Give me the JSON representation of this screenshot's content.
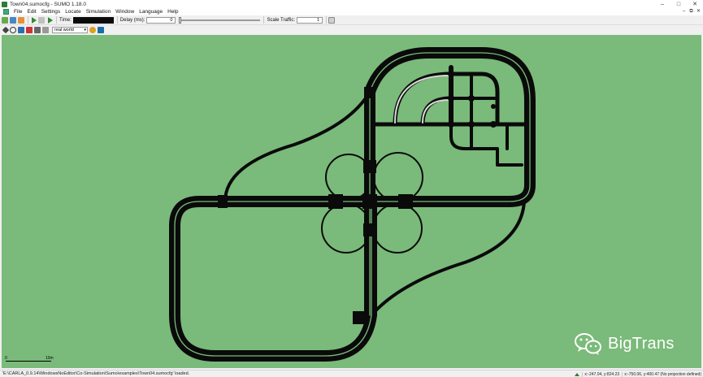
{
  "window": {
    "title": "Town04.sumocfg - SUMO 1.18.0",
    "minimize": "–",
    "maximize": "□",
    "close": "✕"
  },
  "menu": {
    "items": [
      "File",
      "Edit",
      "Settings",
      "Locate",
      "Simulation",
      "Window",
      "Language",
      "Help"
    ],
    "mdi_minimize": "–",
    "mdi_restore": "⧉",
    "mdi_close": "✕"
  },
  "toolbar": {
    "time_label": "Time:",
    "time_value": "",
    "delay_label": "Delay (ms):",
    "delay_value": "0",
    "delay_level": 0,
    "scale_label": "Scale Traffic:",
    "scale_value": "1"
  },
  "view_toolbar": {
    "scheme_value": "real world"
  },
  "scale_bar": {
    "start": "0",
    "end": "10m"
  },
  "watermark": {
    "text": "BigTrans"
  },
  "status": {
    "message": "'E:\\CARLA_0.9.14\\WindowsNoEditor\\Co-Simulation\\Sumo\\examples\\Town04.sumocfg' loaded.",
    "coords": "x:-247.04, y:824.23",
    "geo": "x:-750.06, y:400.47 (No projection defined)"
  },
  "colors": {
    "canvas": "#7aba7a",
    "road": "#0a0a0a",
    "lane_mark": "#7aba7a",
    "time_text": "#2f8d2f"
  }
}
